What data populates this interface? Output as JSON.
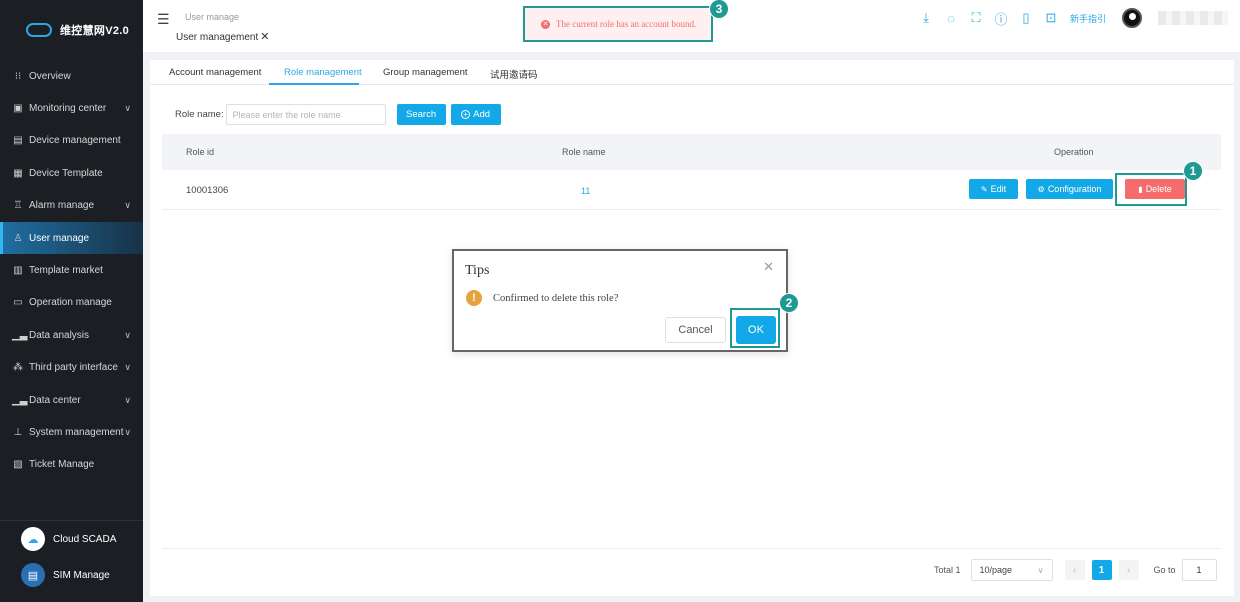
{
  "app": {
    "logo_text": "维控慧网V2.0"
  },
  "sidebar": {
    "items": [
      {
        "label": "Overview",
        "icon": "grid-icon",
        "expandable": false
      },
      {
        "label": "Monitoring center",
        "icon": "monitor-icon",
        "expandable": true
      },
      {
        "label": "Device management",
        "icon": "device-icon",
        "expandable": false
      },
      {
        "label": "Device Template",
        "icon": "template-icon",
        "expandable": false
      },
      {
        "label": "Alarm manage",
        "icon": "alarm-icon",
        "expandable": true
      },
      {
        "label": "User manage",
        "icon": "user-icon",
        "expandable": false,
        "active": true
      },
      {
        "label": "Template market",
        "icon": "market-icon",
        "expandable": false
      },
      {
        "label": "Operation manage",
        "icon": "operation-icon",
        "expandable": false
      },
      {
        "label": "Data analysis",
        "icon": "chart-icon",
        "expandable": true
      },
      {
        "label": "Third party interface",
        "icon": "network-icon",
        "expandable": true
      },
      {
        "label": "Data center",
        "icon": "chart-icon",
        "expandable": true
      },
      {
        "label": "System management",
        "icon": "hierarchy-icon",
        "expandable": true
      },
      {
        "label": "Ticket Manage",
        "icon": "ticket-icon",
        "expandable": false
      }
    ],
    "bottom": [
      {
        "label": "Cloud SCADA",
        "icon": "cloud-icon"
      },
      {
        "label": "SIM Manage",
        "icon": "sim-icon"
      }
    ]
  },
  "header": {
    "breadcrumb": "User manage",
    "page_tab": "User management",
    "alert_message": "The current role has an account bound.",
    "guide_label": "新手指引",
    "icons": [
      "download-icon",
      "chat-icon",
      "fullscreen-icon",
      "info-icon",
      "book-icon",
      "scan-icon"
    ]
  },
  "tabs": [
    "Account management",
    "Role management",
    "Group management",
    "试用邀请码"
  ],
  "active_tab": "Role management",
  "search": {
    "label": "Role name:",
    "placeholder": "Please enter the role name",
    "value": "",
    "search_button": "Search",
    "add_button": "Add"
  },
  "table": {
    "headers": {
      "id": "Role id",
      "name": "Role name",
      "operation": "Operation"
    },
    "rows": [
      {
        "id": "10001306",
        "name": "11"
      }
    ],
    "buttons": {
      "edit": "Edit",
      "config": "Configuration",
      "delete": "Delete"
    }
  },
  "dialog": {
    "title": "Tips",
    "message": "Confirmed to delete this role?",
    "cancel": "Cancel",
    "ok": "OK"
  },
  "annotations": [
    "1",
    "2",
    "3"
  ],
  "pagination": {
    "total": "Total 1",
    "page_size": "10/page",
    "current_page": "1",
    "goto_label": "Go to",
    "goto_value": "1"
  },
  "colors": {
    "accent": "#13a9e8",
    "danger": "#f56c6c",
    "warning": "#e6a23c",
    "highlight": "#1f9a92",
    "sidebar_bg": "#1b1f24"
  }
}
